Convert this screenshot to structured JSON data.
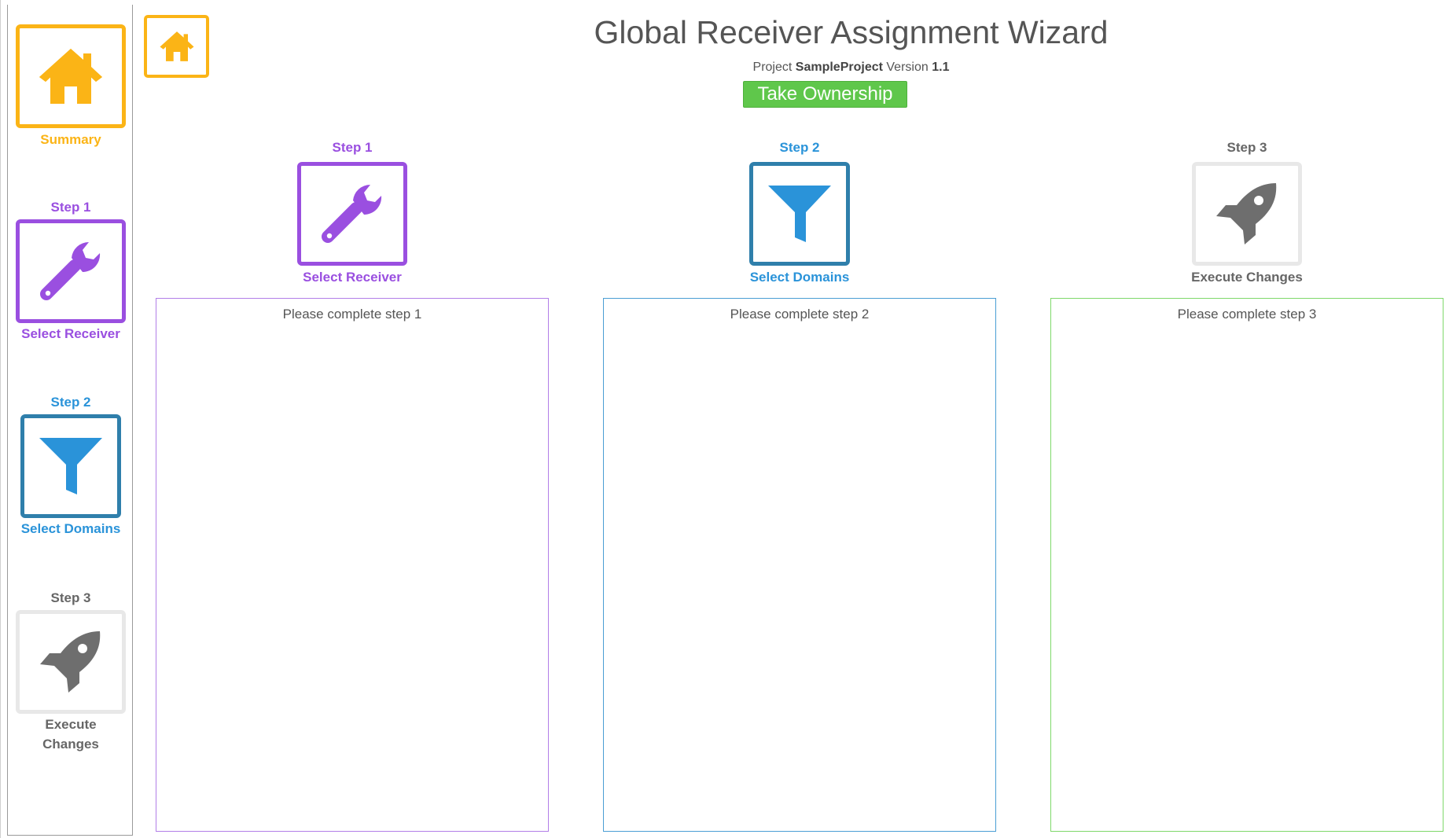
{
  "colors": {
    "summary": "#fbb416",
    "step1": "#9a4fe0",
    "step2": "#2a93d9",
    "step2_border": "#2f7fab",
    "step3": "#666666",
    "step3_border": "#e8e8e8",
    "take_ownership": "#5fc74b",
    "panel3_border": "#7fd86a"
  },
  "sidebar": {
    "summary": {
      "label": "Summary",
      "icon": "home-icon"
    },
    "items": [
      {
        "step": "Step 1",
        "label": "Select Receiver",
        "icon": "wrench-icon"
      },
      {
        "step": "Step 2",
        "label": "Select Domains",
        "icon": "filter-icon"
      },
      {
        "step": "Step 3",
        "label_line1": "Execute",
        "label_line2": "Changes",
        "icon": "rocket-icon"
      }
    ]
  },
  "header": {
    "home_icon": "home-icon",
    "title": "Global Receiver Assignment Wizard",
    "project_prefix": "Project",
    "project_name": "SampleProject",
    "version_prefix": "Version",
    "version": "1.1",
    "take_ownership_label": "Take Ownership"
  },
  "steps": [
    {
      "step": "Step 1",
      "label": "Select Receiver",
      "icon": "wrench-icon",
      "panel_text": "Please complete step 1"
    },
    {
      "step": "Step 2",
      "label": "Select Domains",
      "icon": "filter-icon",
      "panel_text": "Please complete step 2"
    },
    {
      "step": "Step 3",
      "label": "Execute Changes",
      "icon": "rocket-icon",
      "panel_text": "Please complete step 3"
    }
  ]
}
